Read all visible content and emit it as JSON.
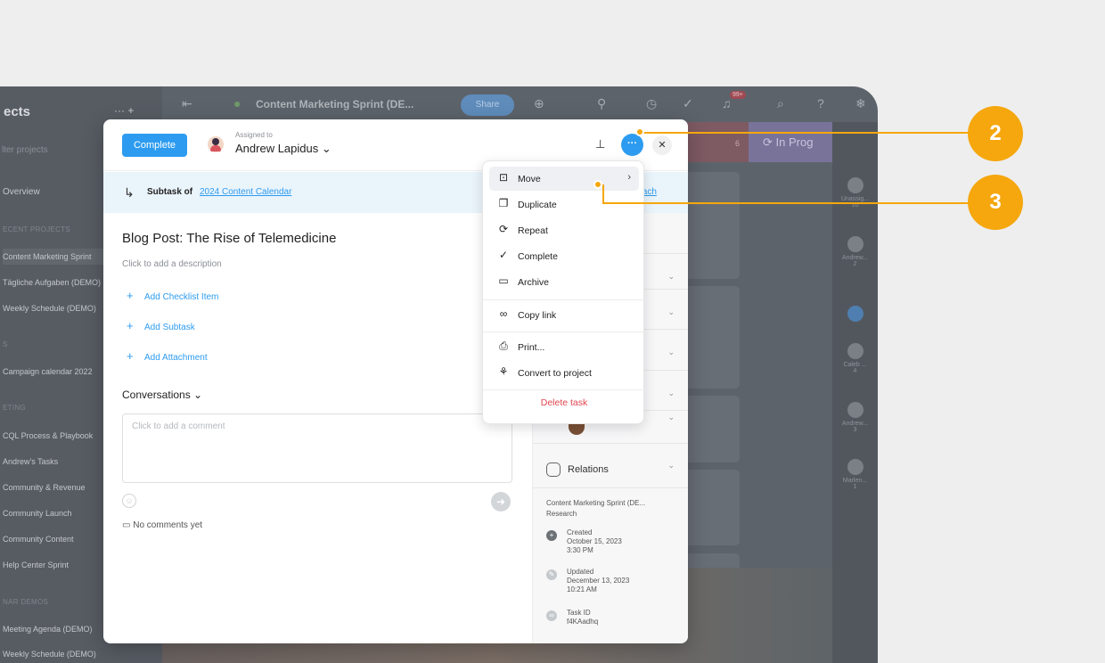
{
  "sidebar": {
    "title": "ects",
    "actions": "··· +",
    "filter_placeholder": "lter projects",
    "overview": "Overview",
    "recent_label": "ECENT PROJECTS",
    "recent": [
      "Content Marketing Sprint",
      "Tägliche Aufgaben (DEMO)",
      "Weekly Schedule (DEMO)"
    ],
    "section_s": "S",
    "campaign": "Campaign calendar 2022",
    "marketing_label": "ETING",
    "marketing": [
      "CQL Process & Playbook",
      "Andrew's Tasks",
      "Community & Revenue",
      "Community Launch",
      "Community Content",
      "Help Center Sprint"
    ],
    "webinar_label": "NAR DEMOS",
    "webinar": [
      "Meeting Agenda (DEMO)",
      "Weekly Schedule (DEMO)"
    ]
  },
  "topbar": {
    "project_name": "Content Marketing Sprint (DE...",
    "share_label": "Share",
    "notif_badge": "99+"
  },
  "board": {
    "red_count": "6",
    "in_progress": "In Prog",
    "people": [
      {
        "name": "Unassig...",
        "count": "10"
      },
      {
        "name": "Andrew...",
        "count": "2"
      },
      {
        "name": "Caleb ...",
        "count": "4"
      },
      {
        "name": "Andrew...",
        "count": "3"
      },
      {
        "name": "Marlen...",
        "count": "1"
      }
    ]
  },
  "modal": {
    "complete_label": "Complete",
    "assigned_to_label": "Assigned to",
    "assignee": "Andrew Lapidus ⌄",
    "more_label": "···",
    "close_label": "✕",
    "subtask_of": "Subtask of",
    "parent_task": "2024 Content Calendar",
    "detach": "tach",
    "title": "Blog Post: The Rise of Telemedicine",
    "description_placeholder": "Click to add a description",
    "add_checklist": "Add Checklist Item",
    "add_subtask": "Add Subtask",
    "add_attachment": "Add Attachment",
    "conversations": "Conversations ⌄",
    "comment_placeholder": "Click to add a comment",
    "no_comments": "No comments yet",
    "relations": "Relations",
    "project_line": "Content Marketing Sprint (DE...",
    "section_line": "Research",
    "created_label": "Created",
    "created_date": "October 15, 2023",
    "created_time": "3:30 PM",
    "updated_label": "Updated",
    "updated_date": "December 13, 2023",
    "updated_time": "10:21 AM",
    "task_id_label": "Task ID",
    "task_id": "f4KAadhq"
  },
  "menu": {
    "items": [
      {
        "label": "Move",
        "icon": "move-icon"
      },
      {
        "label": "Duplicate",
        "icon": "duplicate-icon"
      },
      {
        "label": "Repeat",
        "icon": "repeat-icon"
      },
      {
        "label": "Complete",
        "icon": "check-circle-icon"
      },
      {
        "label": "Archive",
        "icon": "archive-icon"
      },
      {
        "label": "Copy link",
        "icon": "link-icon"
      },
      {
        "label": "Print...",
        "icon": "printer-icon"
      },
      {
        "label": "Convert to project",
        "icon": "rocket-icon"
      }
    ],
    "delete_label": "Delete task"
  },
  "callouts": {
    "step_2": "2",
    "step_3": "3",
    "color": "#F5A70D"
  },
  "colors": {
    "accent": "#2D9CF0",
    "danger": "#E0454F"
  }
}
